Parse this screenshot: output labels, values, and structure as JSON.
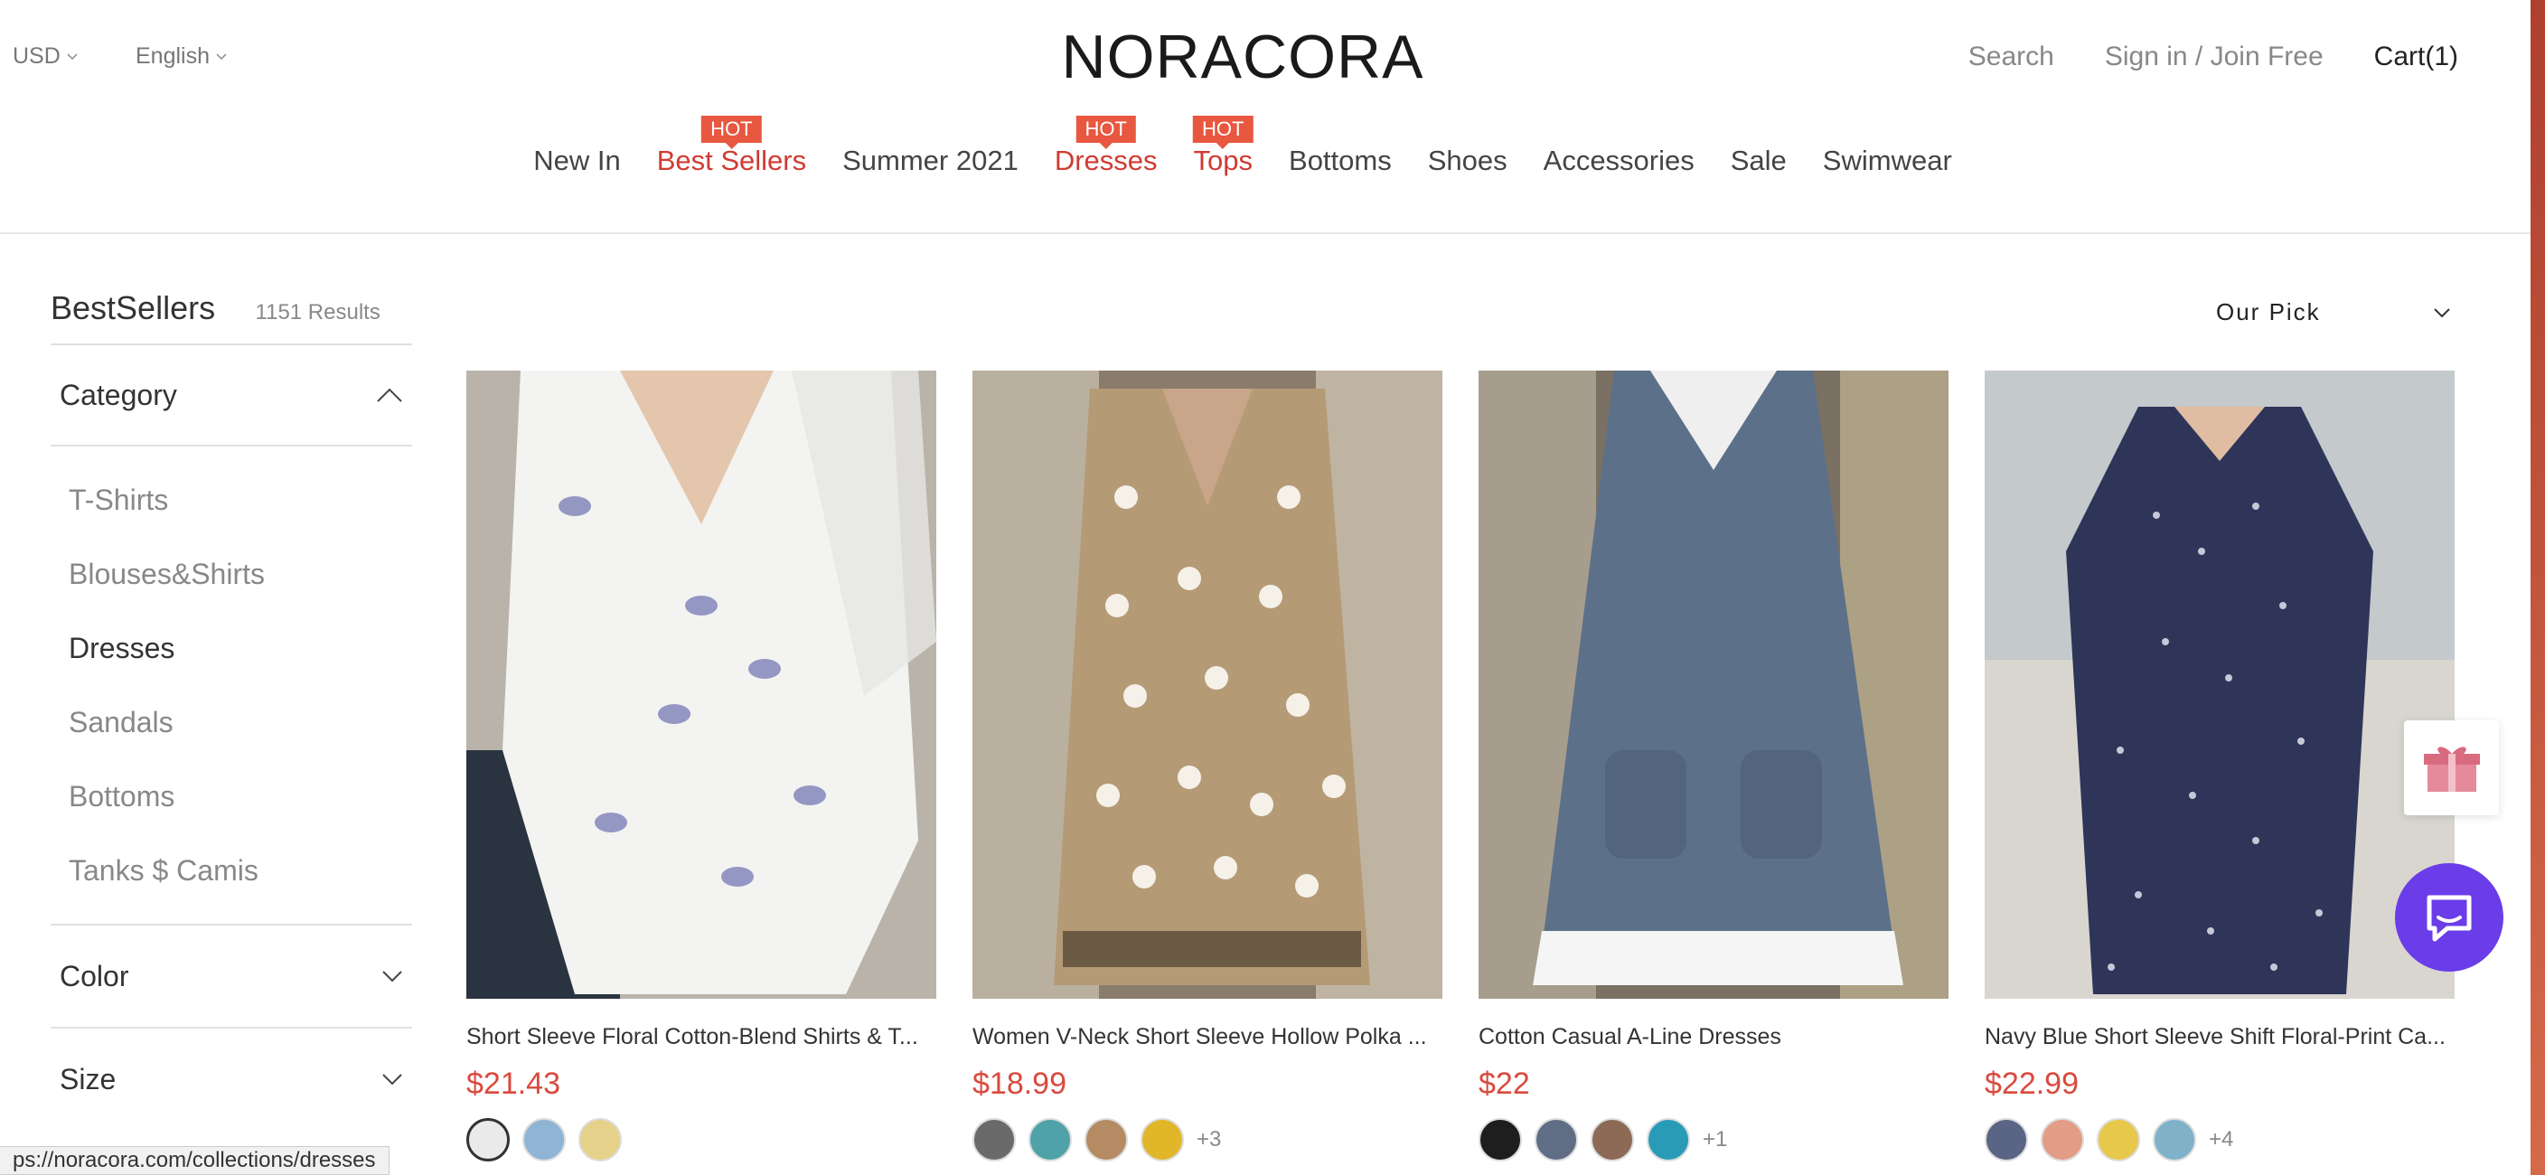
{
  "header": {
    "currency": "USD",
    "language": "English",
    "logo": "NORACORA",
    "search": "Search",
    "signin": "Sign in / Join Free",
    "cart": "Cart(1)"
  },
  "nav": {
    "hot_label": "HOT",
    "items": [
      {
        "label": "New In",
        "hot": false
      },
      {
        "label": "Best Sellers",
        "hot": true
      },
      {
        "label": "Summer 2021",
        "hot": false
      },
      {
        "label": "Dresses",
        "hot": true
      },
      {
        "label": "Tops",
        "hot": true
      },
      {
        "label": "Bottoms",
        "hot": false
      },
      {
        "label": "Shoes",
        "hot": false
      },
      {
        "label": "Accessories",
        "hot": false
      },
      {
        "label": "Sale",
        "hot": false
      },
      {
        "label": "Swimwear",
        "hot": false
      }
    ]
  },
  "listing": {
    "title": "BestSellers",
    "results": "1151 Results",
    "sort": "Our Pick"
  },
  "filters": {
    "category_label": "Category",
    "categories": [
      "T-Shirts",
      "Blouses&Shirts",
      "Dresses",
      "Sandals",
      "Bottoms",
      "Tanks $ Camis"
    ],
    "active_category": "Dresses",
    "color_label": "Color",
    "size_label": "Size"
  },
  "products": [
    {
      "name": "Short Sleeve Floral Cotton-Blend Shirts & T...",
      "price": "$21.43",
      "swatches": [
        "#eaeaea",
        "#8fb4d4",
        "#e6d18a"
      ],
      "more": ""
    },
    {
      "name": "Women V-Neck Short Sleeve Hollow Polka ...",
      "price": "$18.99",
      "swatches": [
        "#6b6a6a",
        "#4fa3a8",
        "#b48b62",
        "#e1b629"
      ],
      "more": "+3"
    },
    {
      "name": "Cotton Casual A-Line Dresses",
      "price": "$22",
      "swatches": [
        "#1e1e1e",
        "#5f6e85",
        "#8c6a55",
        "#2a9bb7"
      ],
      "more": "+1"
    },
    {
      "name": "Navy Blue Short Sleeve Shift Floral-Print Ca...",
      "price": "$22.99",
      "swatches": [
        "#5a6484",
        "#e39c86",
        "#e7c84a",
        "#7fb2c9"
      ],
      "more": "+4"
    }
  ],
  "status_url": "ps://noracora.com/collections/dresses",
  "colors": {
    "accent_red": "#d94a3e",
    "hot_badge": "#e8573f",
    "chat_purple": "#6a3de8"
  }
}
